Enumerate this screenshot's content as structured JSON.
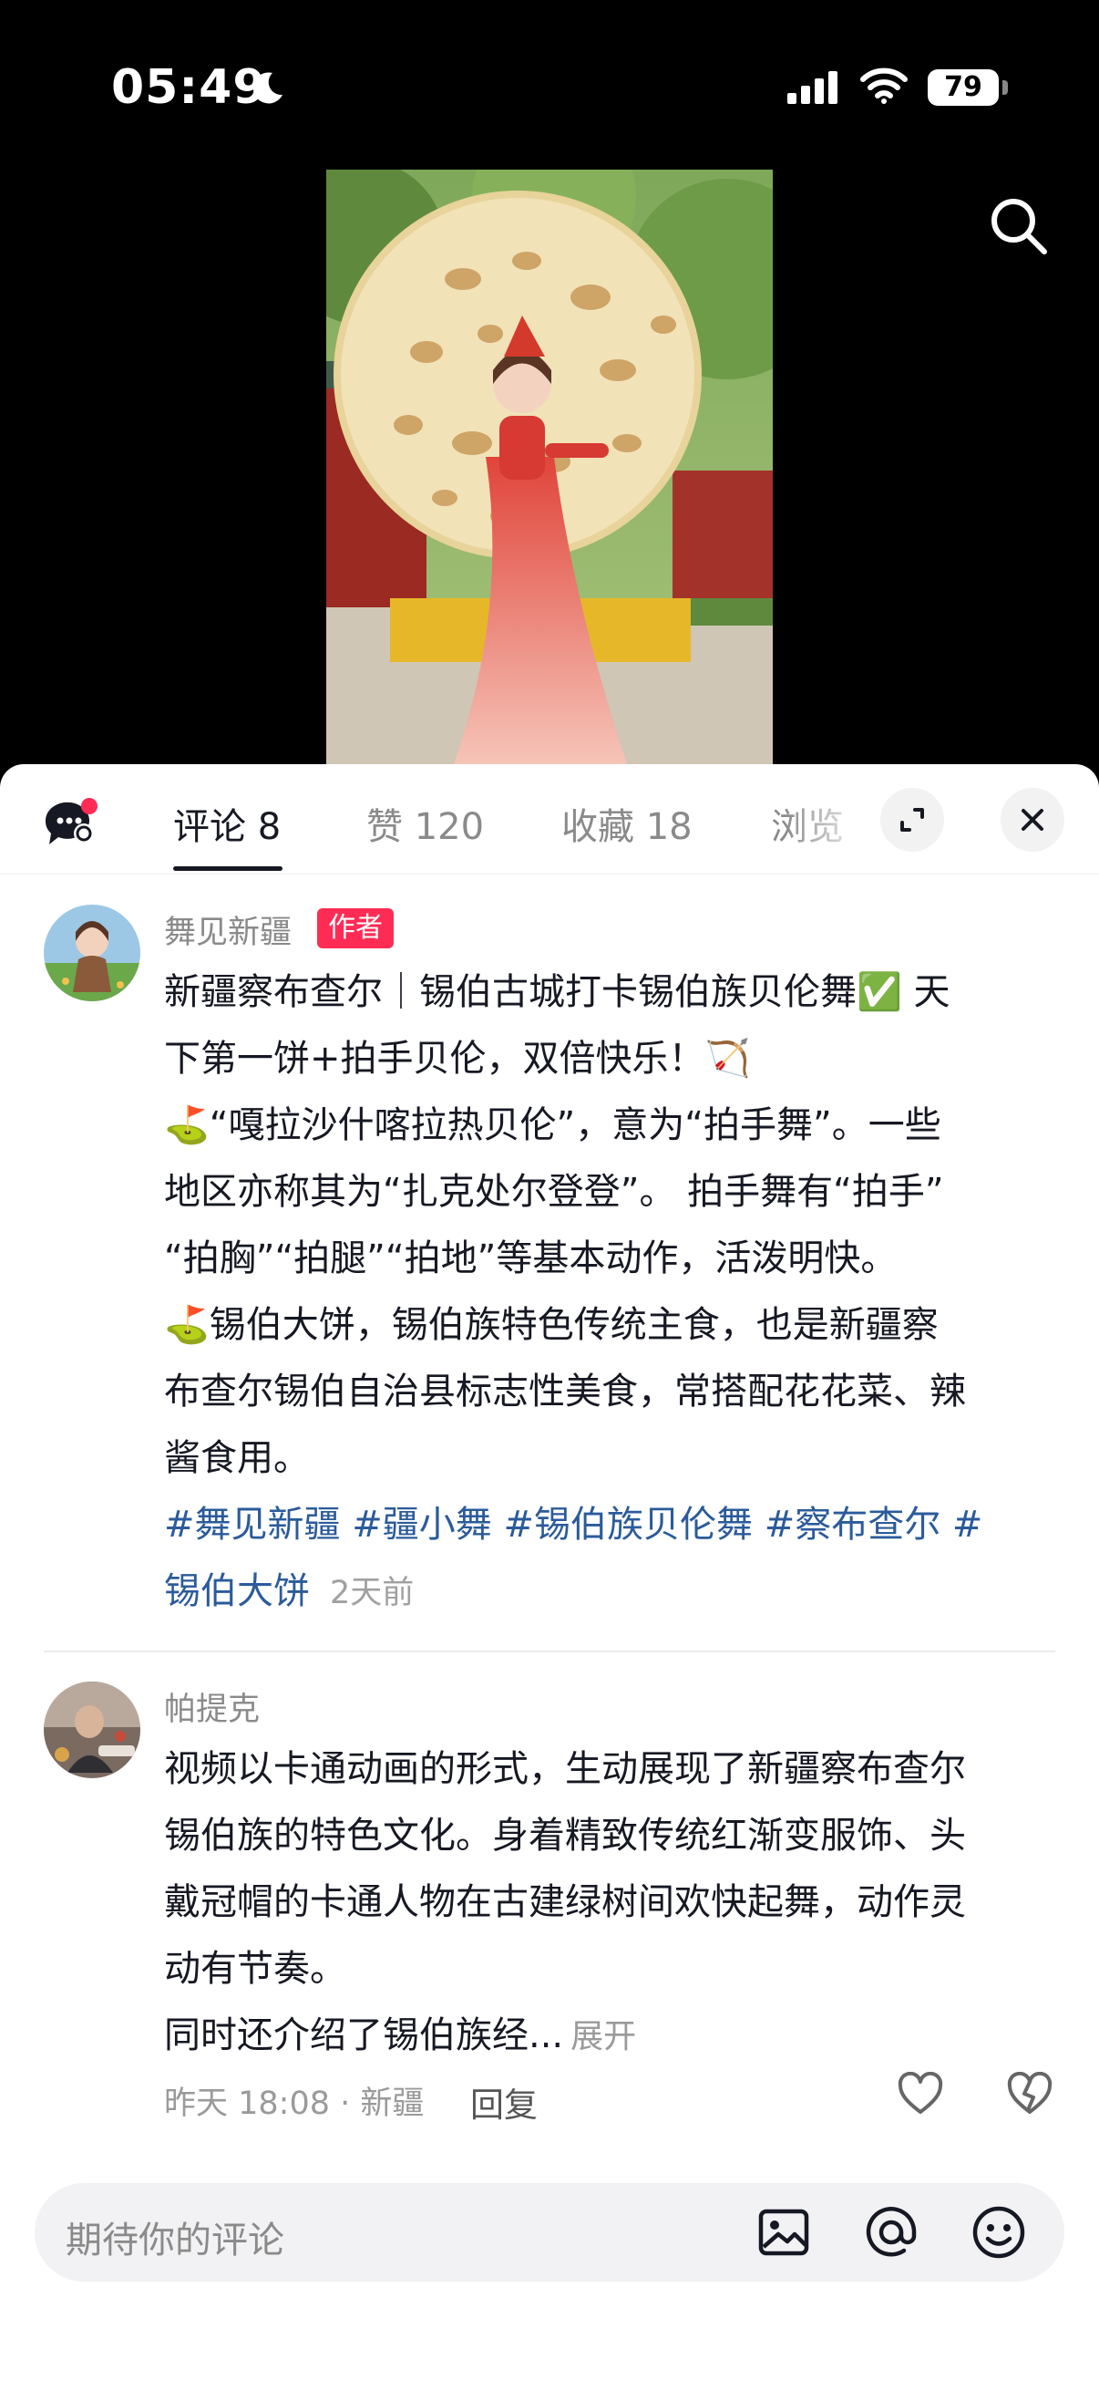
{
  "status_bar": {
    "time": "05:49",
    "battery": "79"
  },
  "tabs": {
    "comments": "评论 8",
    "likes": "赞 120",
    "favorites": "收藏 18",
    "views_truncated": "浏览"
  },
  "author_comment": {
    "username": "舞见新疆",
    "badge": "作者",
    "lines": [
      "新疆察布查尔｜锡伯古城打卡锡伯族贝伦舞✅ 天",
      "下第一饼+拍手贝伦，双倍快乐！🏹",
      "⛳“嘎拉沙什喀拉热贝伦”，意为“拍手舞”。一些",
      "地区亦称其为“扎克处尔登登”。 拍手舞有“拍手”",
      "“拍胸”“拍腿”“拍地”等基本动作，活泼明快。",
      "⛳锡伯大饼，锡伯族特色传统主食，也是新疆察",
      "布查尔锡伯自治县标志性美食，常搭配花花菜、辣",
      "酱食用。"
    ],
    "tags_line1": "#舞见新疆 #疆小舞 #锡伯族贝伦舞 #察布查尔 #",
    "tags_line2": "锡伯大饼",
    "time": "2天前"
  },
  "comment2": {
    "username": "帕提克",
    "lines": [
      "视频以卡通动画的形式，生动展现了新疆察布查尔",
      "锡伯族的特色文化。身着精致传统红渐变服饰、头",
      "戴冠帽的卡通人物在古建绿树间欢快起舞，动作灵",
      "动有节奏。"
    ],
    "last_line": "同时还介绍了锡伯族经...",
    "expand": "展开",
    "meta": "昨天 18:08 · 新疆",
    "reply": "回复"
  },
  "input": {
    "placeholder": "期待你的评论"
  },
  "colors": {
    "accent": "#fe2c55",
    "tag": "#2b5b9a",
    "text": "#161823"
  },
  "icons": [
    "moon-icon",
    "signal-icon",
    "wifi-icon",
    "search-icon",
    "comment-settings-icon",
    "expand-icon",
    "close-icon",
    "heart-icon",
    "broken-heart-icon",
    "image-icon",
    "at-icon",
    "emoji-icon"
  ]
}
